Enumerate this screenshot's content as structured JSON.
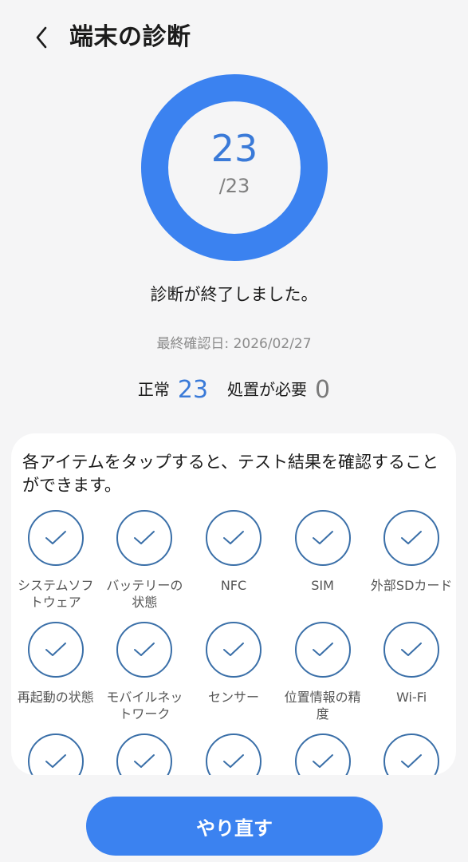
{
  "header": {
    "title": "端末の診断"
  },
  "result": {
    "passed": 23,
    "total_label": "/23",
    "progress_fraction": 1.0,
    "message": "診断が終了しました。",
    "last_check": "最終確認日: 2026/02/27"
  },
  "summary": {
    "normal_label": "正常",
    "normal_count": "23",
    "action_label": "処置が必要",
    "action_count": "0"
  },
  "card": {
    "description": "各アイテムをタップすると、テスト結果を確認することができます。",
    "items": [
      {
        "label": "システムソフトウェア"
      },
      {
        "label": "バッテリーの状態"
      },
      {
        "label": "NFC"
      },
      {
        "label": "SIM"
      },
      {
        "label": "外部SDカード"
      },
      {
        "label": "再起動の状態"
      },
      {
        "label": "モバイルネットワーク"
      },
      {
        "label": "センサー"
      },
      {
        "label": "位置情報の精度"
      },
      {
        "label": "Wi-Fi"
      },
      {
        "label": ""
      },
      {
        "label": ""
      },
      {
        "label": ""
      },
      {
        "label": ""
      },
      {
        "label": ""
      }
    ]
  },
  "footer": {
    "retry_label": "やり直す"
  },
  "colors": {
    "accent": "#3b82f0",
    "ring": "#3b82f0",
    "count_text": "#3a7ad8",
    "check_outline": "#3a6fa8"
  },
  "icons": {
    "back": "chevron-left-icon",
    "item_status": "checkmark-icon"
  }
}
